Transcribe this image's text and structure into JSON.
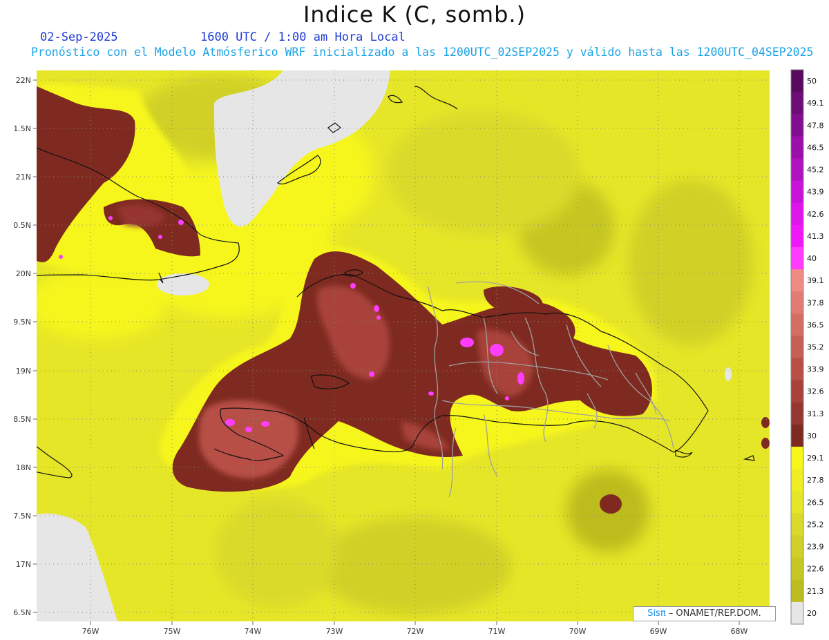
{
  "header": {
    "title": "Indice K (C, somb.)",
    "date": "02-Sep-2025",
    "time": "1600 UTC / 1:00 am Hora Local",
    "description": "Pronóstico con el Modelo Atmósferico WRF inicializado a las 1200UTC_02SEP2025 y válido hasta las  1200UTC_04SEP2025"
  },
  "axes": {
    "lat_labels": [
      "22N",
      "1.5N",
      "21N",
      "0.5N",
      "20N",
      "9.5N",
      "19N",
      "8.5N",
      "18N",
      "7.5N",
      "17N",
      "6.5N"
    ],
    "lon_labels": [
      "76W",
      "75W",
      "74W",
      "73W",
      "72W",
      "71W",
      "70W",
      "69W",
      "68W"
    ]
  },
  "colorbar": {
    "labels": [
      "50",
      "49.1",
      "47.8",
      "46.5",
      "45.2",
      "43.9",
      "42.6",
      "41.3",
      "40",
      "39.1",
      "37.8",
      "36.5",
      "35.2",
      "33.9",
      "32.6",
      "31.3",
      "30",
      "29.1",
      "27.8",
      "26.5",
      "25.2",
      "23.9",
      "22.6",
      "21.3",
      "20"
    ],
    "colors": [
      "#5a0a5e",
      "#6e0c78",
      "#840e90",
      "#9a10a8",
      "#b012c0",
      "#c814d8",
      "#de16ec",
      "#f018f8",
      "#ff3cff",
      "#f08a84",
      "#e27c72",
      "#d56e62",
      "#c76054",
      "#b85046",
      "#a8423a",
      "#963630",
      "#7e2a20",
      "#f6f61a",
      "#eeee22",
      "#e6e628",
      "#dada2a",
      "#d0d028",
      "#c6c624",
      "#bcbc1e",
      "#e6e6e6"
    ]
  },
  "credit": {
    "brand": "Sisπ",
    "org": " – ONAMET/REP.DOM."
  }
}
